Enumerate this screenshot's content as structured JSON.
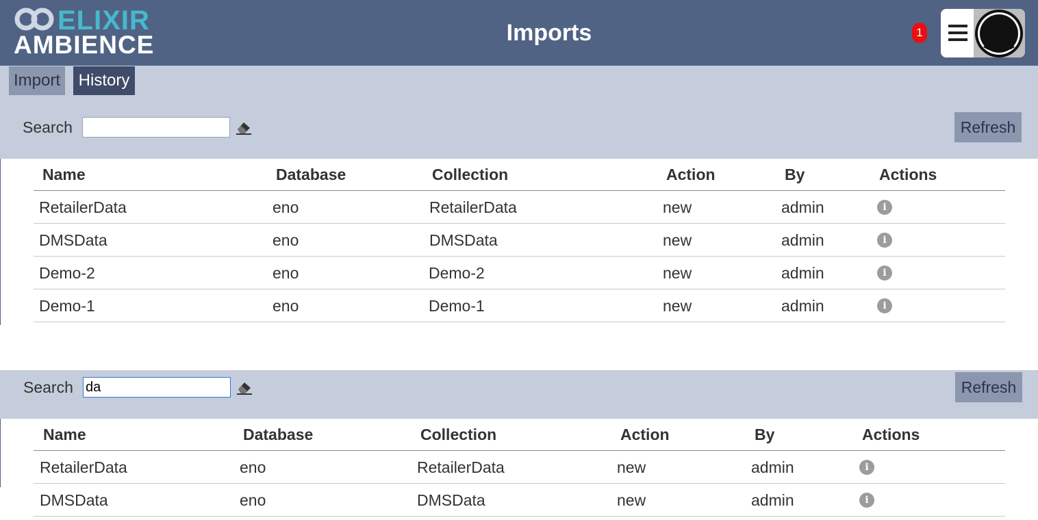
{
  "header": {
    "logo_line1": "ELIXIR",
    "logo_line2": "AMBIENCE",
    "title": "Imports",
    "notification_count": "1"
  },
  "tabs": [
    {
      "label": "Import",
      "active": false
    },
    {
      "label": "History",
      "active": true
    }
  ],
  "panel1": {
    "search_label": "Search",
    "search_value": "",
    "refresh_label": "Refresh",
    "columns": [
      "Name",
      "Database",
      "Collection",
      "Action",
      "By",
      "Actions"
    ],
    "rows": [
      {
        "name": "RetailerData",
        "database": "eno",
        "collection": "RetailerData",
        "action": "new",
        "by": "admin"
      },
      {
        "name": "DMSData",
        "database": "eno",
        "collection": "DMSData",
        "action": "new",
        "by": "admin"
      },
      {
        "name": "Demo-2",
        "database": "eno",
        "collection": "Demo-2",
        "action": "new",
        "by": "admin"
      },
      {
        "name": "Demo-1",
        "database": "eno",
        "collection": "Demo-1",
        "action": "new",
        "by": "admin"
      }
    ]
  },
  "panel2": {
    "search_label": "Search",
    "search_value": "da",
    "refresh_label": "Refresh",
    "columns": [
      "Name",
      "Database",
      "Collection",
      "Action",
      "By",
      "Actions"
    ],
    "rows": [
      {
        "name": "RetailerData",
        "database": "eno",
        "collection": "RetailerData",
        "action": "new",
        "by": "admin"
      },
      {
        "name": "DMSData",
        "database": "eno",
        "collection": "DMSData",
        "action": "new",
        "by": "admin"
      }
    ]
  },
  "colors": {
    "header_bg": "#506385",
    "subbar_bg": "#c5ccdb",
    "tab_active_bg": "#3f4b68",
    "tab_inactive_bg": "#8b97ae",
    "logo_accent": "#48b8cc",
    "badge": "#e81010"
  },
  "icons": {
    "info": "i",
    "clear": "eraser-icon",
    "menu": "hamburger-menu-icon",
    "avatar": "user-avatar-icon"
  }
}
